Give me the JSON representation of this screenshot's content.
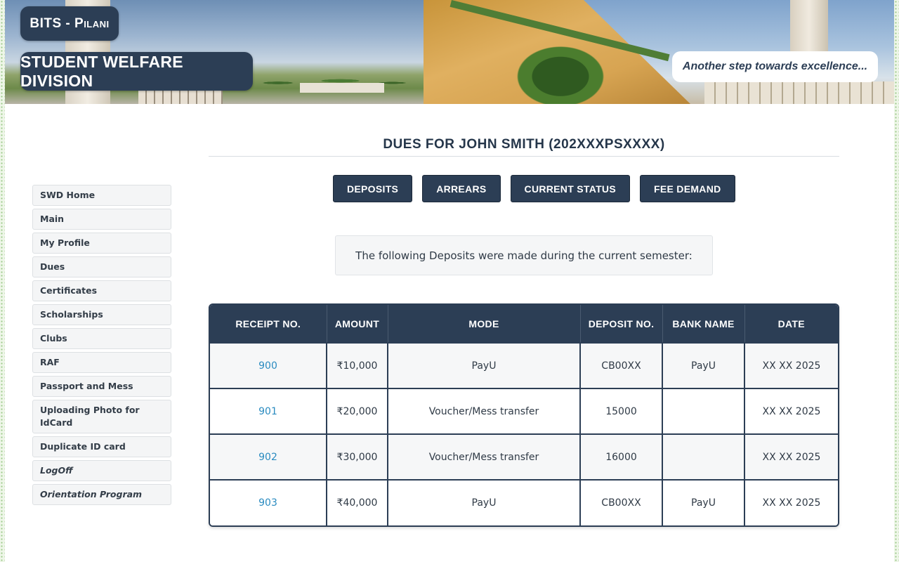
{
  "header": {
    "brand": "BITS - Pilani",
    "division": "STUDENT WELFARE DIVISION",
    "tagline": "Another step towards excellence..."
  },
  "sidebar": {
    "items": [
      {
        "label": "SWD Home"
      },
      {
        "label": "Main"
      },
      {
        "label": "My Profile"
      },
      {
        "label": "Dues"
      },
      {
        "label": "Certificates"
      },
      {
        "label": "Scholarships"
      },
      {
        "label": "Clubs"
      },
      {
        "label": "RAF"
      },
      {
        "label": "Passport and Mess"
      },
      {
        "label": "Uploading Photo for IdCard"
      },
      {
        "label": "Duplicate ID card"
      },
      {
        "label": "LogOff"
      },
      {
        "label": "Orientation Program"
      }
    ]
  },
  "main": {
    "title": "DUES FOR JOHN SMITH (202XXXPSXXXX)",
    "tabs": [
      {
        "label": "DEPOSITS"
      },
      {
        "label": "ARREARS"
      },
      {
        "label": "CURRENT STATUS"
      },
      {
        "label": "FEE DEMAND"
      }
    ],
    "notice": "The following Deposits were made during the current semester:",
    "table": {
      "columns": [
        "RECEIPT NO.",
        "AMOUNT",
        "MODE",
        "DEPOSIT NO.",
        "BANK NAME",
        "DATE"
      ],
      "rows": [
        {
          "receipt": "900",
          "amount": "₹10,000",
          "mode": "PayU",
          "deposit_no": "CB00XX",
          "bank": "PayU",
          "date": "XX XX 2025"
        },
        {
          "receipt": "901",
          "amount": "₹20,000",
          "mode": "Voucher/Mess transfer",
          "deposit_no": "15000",
          "bank": "",
          "date": "XX XX 2025"
        },
        {
          "receipt": "902",
          "amount": "₹30,000",
          "mode": "Voucher/Mess transfer",
          "deposit_no": "16000",
          "bank": "",
          "date": "XX XX 2025"
        },
        {
          "receipt": "903",
          "amount": "₹40,000",
          "mode": "PayU",
          "deposit_no": "CB00XX",
          "bank": "PayU",
          "date": "XX XX 2025"
        }
      ]
    }
  },
  "colors": {
    "primary": "#2c3e55",
    "link": "#2a8bc0",
    "sidebar_bg": "#f4f5f6"
  }
}
